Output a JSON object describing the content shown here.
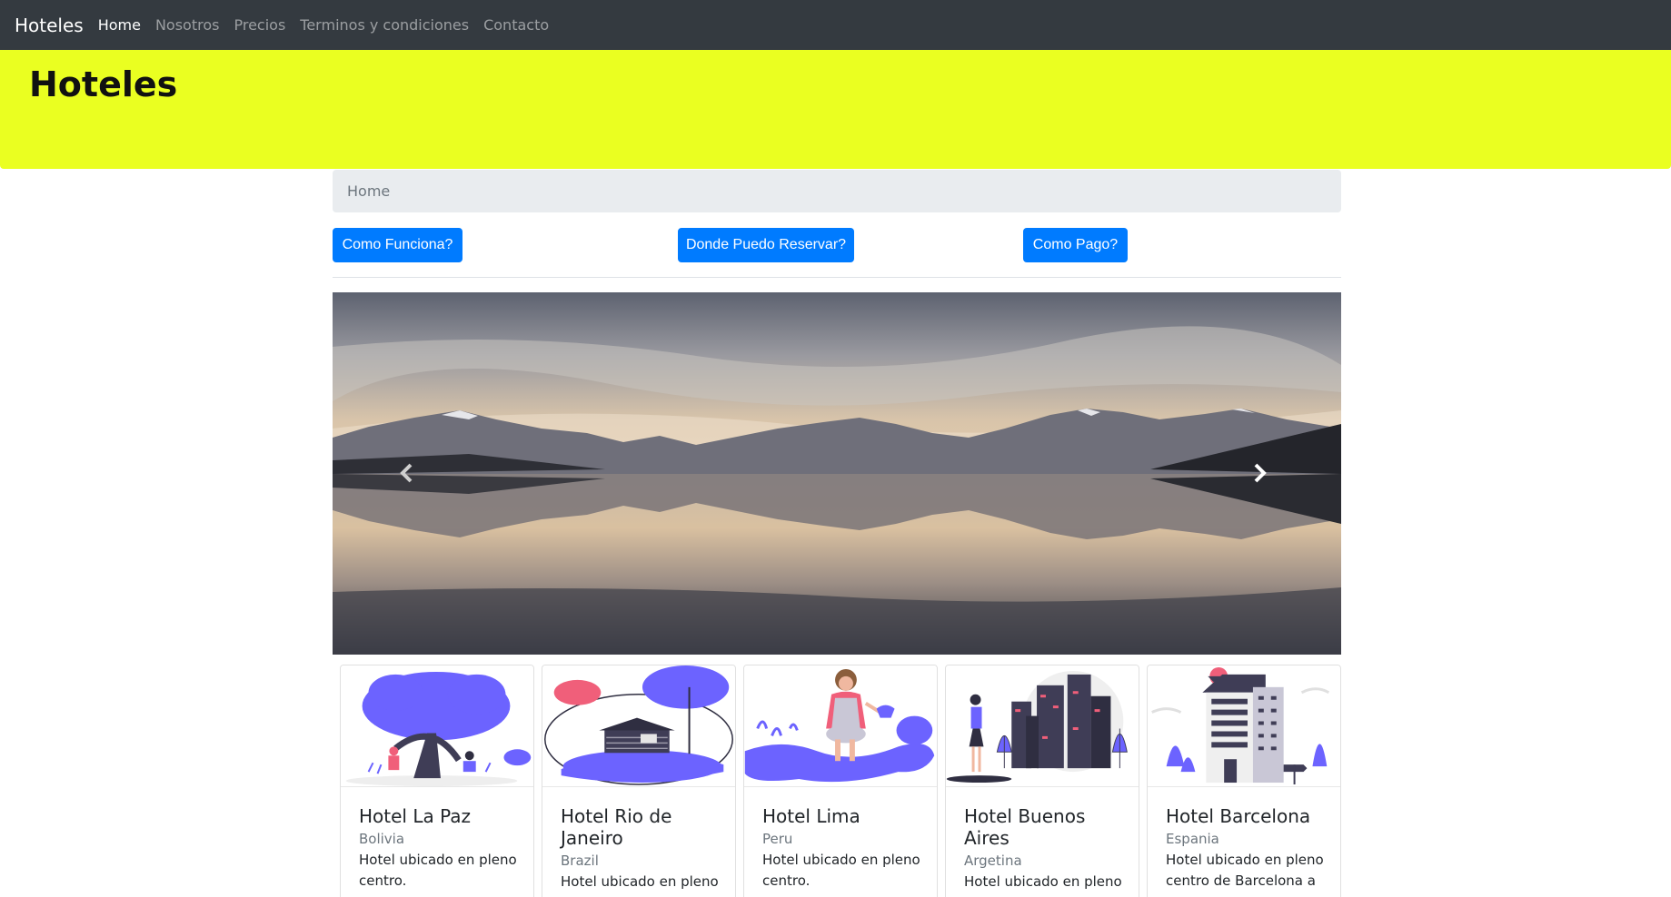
{
  "navbar": {
    "brand": "Hoteles",
    "links": [
      {
        "label": "Home",
        "active": true
      },
      {
        "label": "Nosotros"
      },
      {
        "label": "Precios"
      },
      {
        "label": "Terminos y condiciones"
      },
      {
        "label": "Contacto"
      }
    ]
  },
  "jumbotron": {
    "title": "Hoteles",
    "background": "#eaff21"
  },
  "breadcrumb": {
    "item": "Home"
  },
  "buttons": [
    "Como Funciona?",
    "Donde Puedo Reservar?",
    "Como Pago?"
  ],
  "carousel": {
    "image": "mountain lake reflection at dusk",
    "prev_icon": "chevron-left-icon",
    "next_icon": "chevron-right-icon"
  },
  "cards": [
    {
      "title": "Hotel La Paz",
      "subtitle": "Bolivia",
      "text": "Hotel ubicado en pleno centro."
    },
    {
      "title": "Hotel Rio de Janeiro",
      "subtitle": "Brazil",
      "text": "Hotel ubicado en pleno"
    },
    {
      "title": "Hotel Lima",
      "subtitle": "Peru",
      "text": "Hotel ubicado en pleno centro."
    },
    {
      "title": "Hotel Buenos Aires",
      "subtitle": "Argetina",
      "text": "Hotel ubicado en pleno"
    },
    {
      "title": "Hotel Barcelona",
      "subtitle": "Espania",
      "text": "Hotel ubicado en pleno centro de Barcelona a"
    }
  ],
  "colors": {
    "navbar": "#343a40",
    "primary": "#007bff",
    "illustration": "#6c63ff",
    "accent": "#f05f7a"
  }
}
